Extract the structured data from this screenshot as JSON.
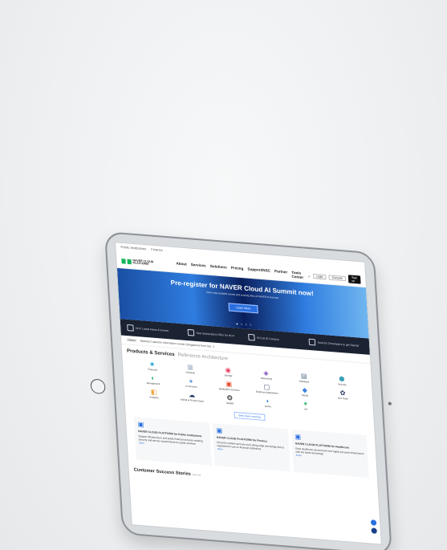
{
  "utility_links": [
    "Public Institutions",
    "Finance"
  ],
  "nav": {
    "logo_text": "NAVER CLOUD PLATFORM",
    "menu": [
      "About",
      "Services",
      "Solutions",
      "Pricing",
      "Support/NSC",
      "Partner",
      "Tools Center"
    ],
    "right": {
      "login": "Login",
      "console": "Console",
      "signup": "Sign up"
    }
  },
  "hero": {
    "title": "Pre-register for NAVER Cloud AI Summit now!",
    "subtitle": "Don't miss detailed events and exciting talks at NAVER AI lectures",
    "cta": "Learn More",
    "dots": "● ○ ○ ○"
  },
  "strip": [
    "NCP Latest News & Events",
    "New Subscription Offer for NCP",
    "NCLOUD Campus",
    "Tools for Developers to get Started"
  ],
  "notice": {
    "tag": "Notice",
    "text": "[Notice] Customer Information Center (Singapore) from Jan. 2"
  },
  "products": {
    "title": "Products & Services",
    "tab2": "Reference Architecture",
    "items": [
      {
        "icon": "star-icon",
        "glyph": "★",
        "color": "#1aa3d9",
        "label": "Featured"
      },
      {
        "icon": "server-icon",
        "glyph": "▦",
        "color": "#a7b5c9",
        "label": "Compute"
      },
      {
        "icon": "storage-icon",
        "glyph": "◉",
        "color": "#e83e61",
        "label": "Storage"
      },
      {
        "icon": "network-icon",
        "glyph": "◈",
        "color": "#7b4bb8",
        "label": "Networking"
      },
      {
        "icon": "database-icon",
        "glyph": "▤",
        "color": "#5b6d8a",
        "label": "Database"
      },
      {
        "icon": "security-icon",
        "glyph": "⬢",
        "color": "#3aa0b5",
        "label": "Security"
      },
      {
        "icon": "management-icon",
        "glyph": "◐",
        "color": "#2bb673",
        "label": "Management"
      },
      {
        "icon": "ai-icon",
        "glyph": "●",
        "color": "#6fa2e0",
        "label": "AI Services"
      },
      {
        "icon": "app-services-icon",
        "glyph": "▣",
        "color": "#e64a2d",
        "label": "Application Services"
      },
      {
        "icon": "business-app-icon",
        "glyph": "▢",
        "color": "#3d4d7a",
        "label": "Business Applications"
      },
      {
        "icon": "media-icon",
        "glyph": "◆",
        "color": "#3a82e0",
        "label": "Media"
      },
      {
        "icon": "devtools-icon",
        "glyph": "✿",
        "color": "#2b3a66",
        "label": "Dev Tools"
      },
      {
        "icon": "analytics-icon",
        "glyph": "◧",
        "color": "#f2a23b",
        "label": "Analytics"
      },
      {
        "icon": "hybrid-cloud-icon",
        "glyph": "☁",
        "color": "#2b3a66",
        "label": "Hybrid & Private Cloud"
      },
      {
        "icon": "nav-icon",
        "glyph": "❂",
        "color": "#222222",
        "label": "NAVER"
      },
      {
        "icon": "game-icon",
        "glyph": "◗",
        "color": "#3a82e0",
        "label": "Game"
      },
      {
        "icon": "iot-icon",
        "glyph": "✦",
        "color": "#2bb673",
        "label": "IoT"
      }
    ],
    "more": "View more services"
  },
  "cards": [
    {
      "icon": "public-sector-icon",
      "color": "#2a6fe0",
      "title": "NAVER CLOUD PLATFORM for Public Institutions",
      "desc": "Support infrastructure and public financial services meeting security and service requirements for public services",
      "link": "more"
    },
    {
      "icon": "finance-icon",
      "color": "#2a6fe0",
      "title": "NAVER CLOUD PLATFORM for Finance",
      "desc": "Cloud for reliable services and cutting-edge technology that is regulated for use on financial institutions",
      "link": "more"
    },
    {
      "icon": "healthcare-icon",
      "color": "#2a6fe0",
      "title": "NAVER CLOUD PLATFORM for Healthcare",
      "desc": "Easy healthcare service built from highly secured infrastructure with the latest technology",
      "link": "more"
    }
  ],
  "customer": {
    "title": "Customer Success Stories",
    "sub": "View All"
  }
}
